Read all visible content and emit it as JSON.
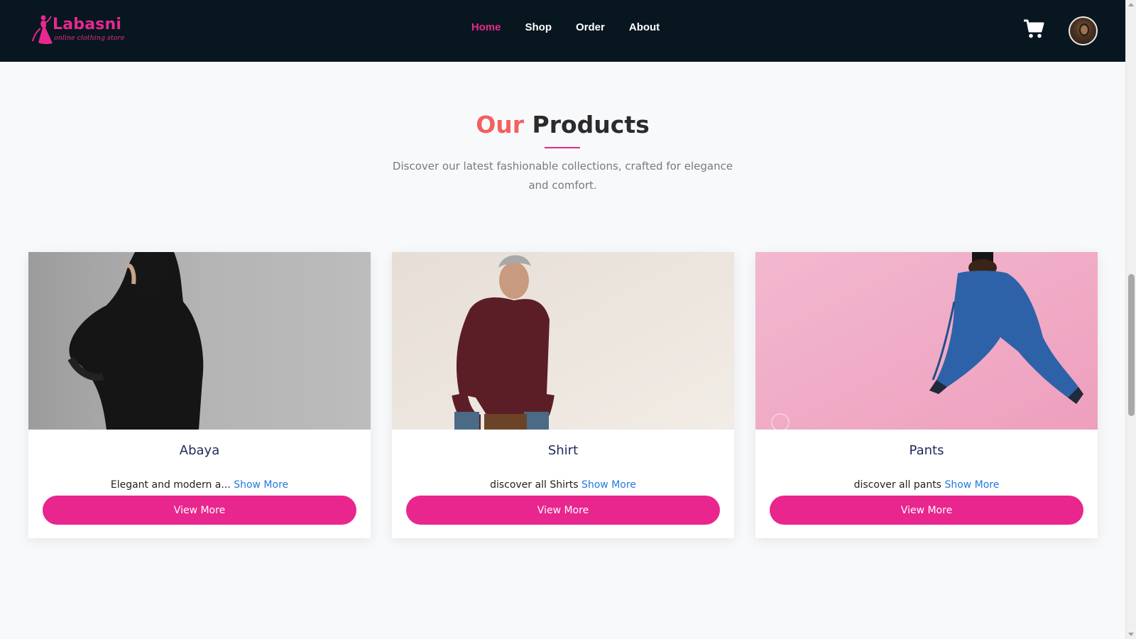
{
  "brand": {
    "name": "Labasni",
    "tagline": "online clothing store",
    "accent": "#e8288f"
  },
  "nav": {
    "links": [
      {
        "label": "Home",
        "active": true
      },
      {
        "label": "Shop",
        "active": false
      },
      {
        "label": "Order",
        "active": false
      },
      {
        "label": "About",
        "active": false
      }
    ],
    "cart_icon": "cart-icon",
    "avatar_icon": "user-avatar"
  },
  "section": {
    "title_accent": "Our",
    "title_rest": "Products",
    "subtitle": "Discover our latest fashionable collections, crafted for elegance and comfort."
  },
  "products": [
    {
      "name": "Abaya",
      "description": "Elegant and modern a...",
      "show_more": "Show More",
      "button": "View More"
    },
    {
      "name": "Shirt",
      "description": "discover all Shirts",
      "show_more": "Show More",
      "button": "View More"
    },
    {
      "name": "Pants",
      "description": "discover all pants",
      "show_more": "Show More",
      "button": "View More"
    }
  ],
  "colors": {
    "navbar": "#07161f",
    "button": "#e8268e",
    "title_accent": "#f2605f",
    "link": "#1f7ae0"
  }
}
